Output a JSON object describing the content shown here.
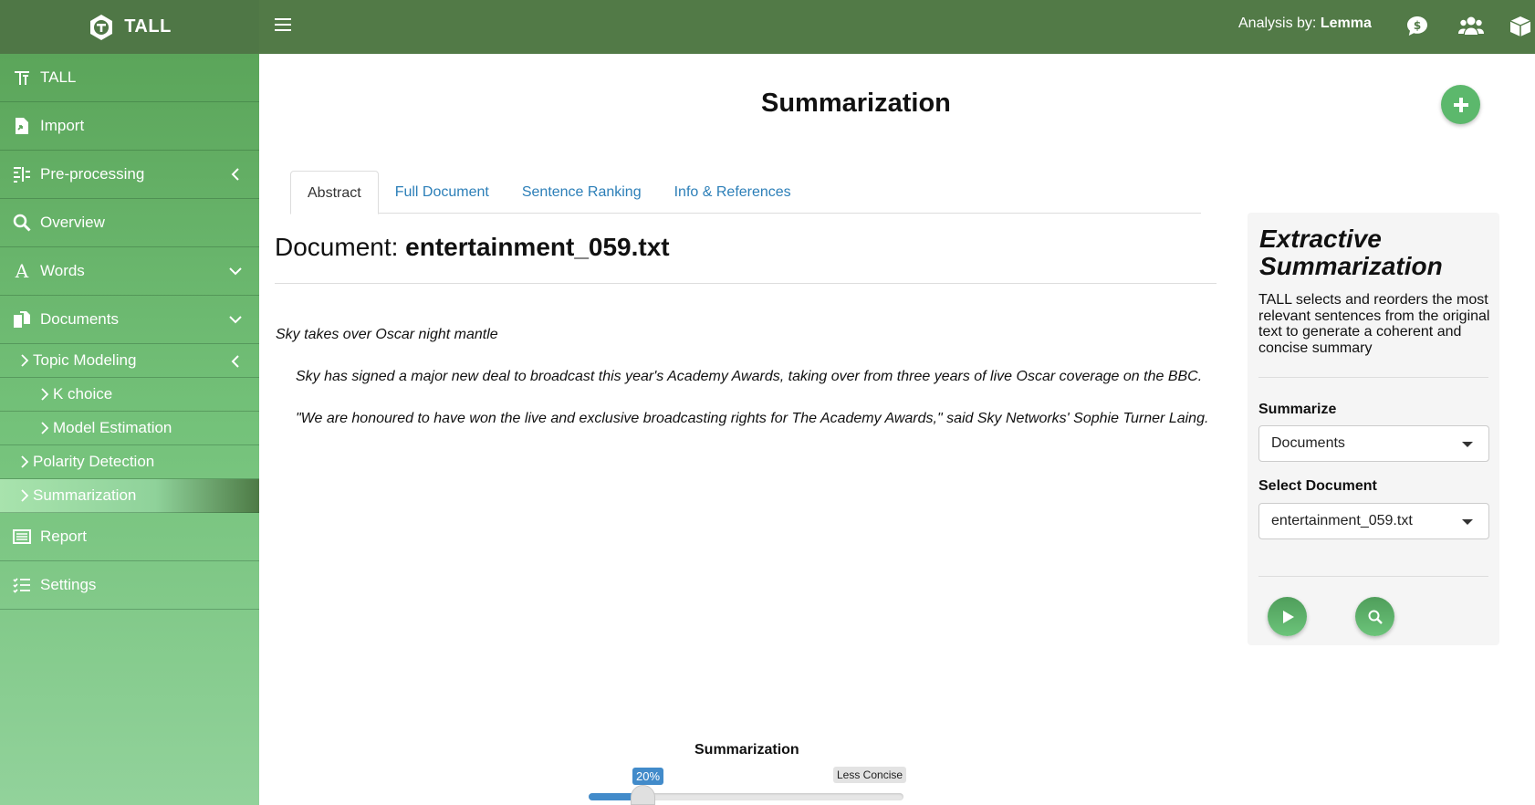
{
  "header": {
    "brand": "TALL",
    "analysis_prefix": "Analysis by: ",
    "analysis_name": "Lemma",
    "icons": [
      "dollar-chat-icon",
      "users-icon",
      "cube-icon"
    ]
  },
  "sidebar": {
    "items": [
      {
        "label": "TALL",
        "icon": "tall-text-icon"
      },
      {
        "label": "Import",
        "icon": "file-import-icon"
      },
      {
        "label": "Pre-processing",
        "icon": "preprocessing-icon"
      },
      {
        "label": "Overview",
        "icon": "search-icon"
      },
      {
        "label": "Words",
        "icon": "font-icon"
      },
      {
        "label": "Documents",
        "icon": "documents-icon"
      }
    ],
    "sub_items": [
      {
        "label": "Topic Modeling"
      },
      {
        "label": "K choice"
      },
      {
        "label": "Model Estimation"
      },
      {
        "label": "Polarity Detection"
      },
      {
        "label": "Summarization"
      }
    ],
    "bottom_items": [
      {
        "label": "Report",
        "icon": "report-icon"
      },
      {
        "label": "Settings",
        "icon": "settings-list-icon"
      }
    ]
  },
  "main": {
    "title": "Summarization",
    "tabs": [
      {
        "label": "Abstract"
      },
      {
        "label": "Full Document"
      },
      {
        "label": "Sentence Ranking"
      },
      {
        "label": "Info & References"
      }
    ],
    "doc_prefix": "Document: ",
    "doc_name": "entertainment_059.txt",
    "sentences": [
      "Sky takes over Oscar night mantle",
      "Sky has signed a major new deal to broadcast this year's Academy Awards, taking over from three years of live Oscar coverage on the BBC.",
      "\"We are honoured to have won the live and exclusive broadcasting rights for The Academy Awards,\" said Sky Networks' Sophie Turner Laing."
    ]
  },
  "panel": {
    "title_line1": "Extractive",
    "title_line2": "Summarization",
    "description": "TALL selects and reorders the most relevant sentences from the original text to generate a coherent and concise summary",
    "summarize_label": "Summarize",
    "summarize_value": "Documents",
    "select_doc_label": "Select Document",
    "select_doc_value": "entertainment_059.txt"
  },
  "slider": {
    "title": "Summarization",
    "value_label": "20%",
    "end_label": "Less Concise",
    "value_fraction": 0.17
  },
  "colors": {
    "header": "#527a47",
    "accent_green": "#5cb86c",
    "link_blue": "#2c7fb8",
    "slider_blue": "#428bca"
  }
}
